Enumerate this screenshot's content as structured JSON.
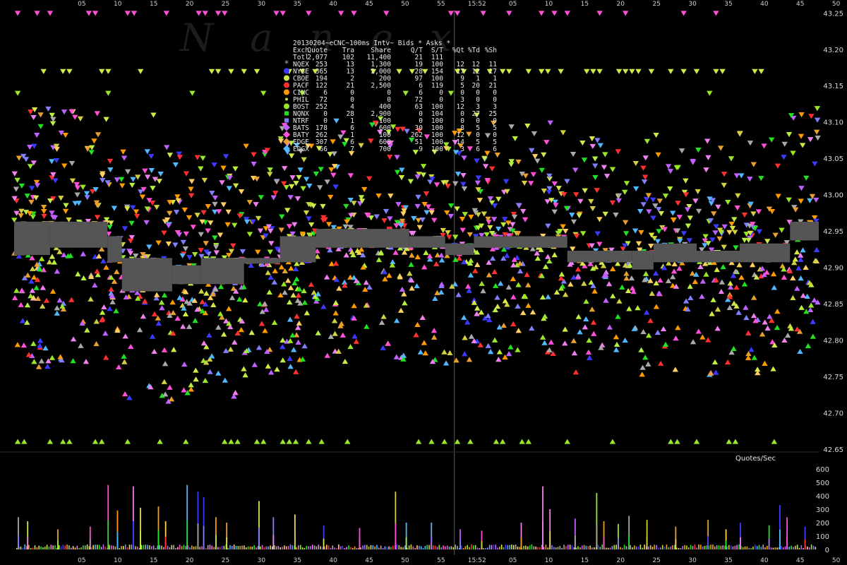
{
  "chart_data": {
    "type": "scatter",
    "title": "20130204~eCNC~100ms Intv~ Bids * Asks *",
    "watermark": "Nanex",
    "price_axis": {
      "min": 42.65,
      "max": 43.26,
      "ticks": [
        "43.25",
        "43.20",
        "43.15",
        "43.10",
        "43.05",
        "43.00",
        "42.95",
        "42.90",
        "42.85",
        "42.80",
        "42.75",
        "42.70",
        "42.65"
      ]
    },
    "volume_axis": {
      "label": "Quotes/Sec",
      "min": 0,
      "max": 620,
      "ticks": [
        "600",
        "500",
        "400",
        "300",
        "200",
        "100",
        "0"
      ]
    },
    "time_axis": {
      "min": 0,
      "max": 112,
      "center_label": "15:52",
      "center_minute": 60,
      "ticks": [
        {
          "m": 5,
          "label": "05"
        },
        {
          "m": 10,
          "label": "10"
        },
        {
          "m": 15,
          "label": "15"
        },
        {
          "m": 20,
          "label": "20"
        },
        {
          "m": 25,
          "label": "25"
        },
        {
          "m": 30,
          "label": "30"
        },
        {
          "m": 35,
          "label": "35"
        },
        {
          "m": 40,
          "label": "40"
        },
        {
          "m": 45,
          "label": "45"
        },
        {
          "m": 50,
          "label": "50"
        },
        {
          "m": 55,
          "label": "55"
        },
        {
          "m": 60,
          "label": "15:52"
        },
        {
          "m": 65,
          "label": "05"
        },
        {
          "m": 70,
          "label": "10"
        },
        {
          "m": 75,
          "label": "15"
        },
        {
          "m": 80,
          "label": "20"
        },
        {
          "m": 85,
          "label": "25"
        },
        {
          "m": 90,
          "label": "30"
        },
        {
          "m": 95,
          "label": "35"
        },
        {
          "m": 100,
          "label": "40"
        },
        {
          "m": 105,
          "label": "45"
        },
        {
          "m": 110,
          "label": "50"
        }
      ]
    },
    "legend": {
      "headers": [
        "Exch",
        "Quote",
        "Tra",
        "Share",
        "Q/T",
        "S/T",
        "%Qt",
        "%Td",
        "%Sh"
      ],
      "total": [
        "Totl",
        "2,077",
        "102",
        "11,400",
        "21",
        "111",
        "",
        "",
        ""
      ],
      "rows": [
        {
          "exch": "NQEX",
          "color": "#a9a9a9",
          "shape": "asterisk",
          "cells": [
            "253",
            "13",
            "1,300",
            "19",
            "100",
            "12",
            "12",
            "11"
          ]
        },
        {
          "exch": "NYSE",
          "color": "#3b3bff",
          "shape": "circle",
          "cells": [
            "365",
            "13",
            "2,000",
            "28",
            "154",
            "17",
            "12",
            "17"
          ]
        },
        {
          "exch": "CBOE",
          "color": "#d4e84a",
          "shape": "circle",
          "cells": [
            "194",
            "2",
            "200",
            "97",
            "100",
            "9",
            "1",
            "1"
          ]
        },
        {
          "exch": "PACF",
          "color": "#ff3030",
          "shape": "circle",
          "cells": [
            "122",
            "21",
            "2,500",
            "6",
            "119",
            "5",
            "20",
            "21"
          ]
        },
        {
          "exch": "CINC",
          "color": "#ff9a00",
          "shape": "circle",
          "cells": [
            "6",
            "0",
            "0",
            "6",
            "0",
            "0",
            "0",
            "0"
          ]
        },
        {
          "exch": "PHIL",
          "color": "#d0d040",
          "shape": "dot",
          "cells": [
            "72",
            "0",
            "0",
            "72",
            "0",
            "3",
            "0",
            "0"
          ]
        },
        {
          "exch": "BOST",
          "color": "#9ae62a",
          "shape": "circle",
          "cells": [
            "252",
            "4",
            "400",
            "63",
            "100",
            "12",
            "3",
            "3"
          ]
        },
        {
          "exch": "NQNX",
          "color": "#22e022",
          "shape": "square",
          "cells": [
            "0",
            "28",
            "2,900",
            "0",
            "104",
            "0",
            "27",
            "25"
          ]
        },
        {
          "exch": "NTRF",
          "color": "#8080ff",
          "shape": "square",
          "cells": [
            "0",
            "1",
            "100",
            "0",
            "100",
            "0",
            "0",
            "0"
          ]
        },
        {
          "exch": "BATS",
          "color": "#c060ff",
          "shape": "diamond",
          "cells": [
            "178",
            "6",
            "600",
            "30",
            "100",
            "8",
            "5",
            "5"
          ]
        },
        {
          "exch": "BATY",
          "color": "#ff50d8",
          "shape": "diamond",
          "cells": [
            "262",
            "1",
            "100",
            "262",
            "100",
            "12",
            "0",
            "0"
          ]
        },
        {
          "exch": "EDGE",
          "color": "#e8a030",
          "shape": "diamond",
          "cells": [
            "307",
            "6",
            "600",
            "51",
            "100",
            "14",
            "5",
            "5"
          ]
        },
        {
          "exch": "EDGX",
          "color": "#4fb8ff",
          "shape": "diamond",
          "cells": [
            "66",
            "7",
            "700",
            "9",
            "100",
            "3",
            "6",
            "6"
          ]
        }
      ]
    },
    "nbbo_band": [
      {
        "t0": 0,
        "t1": 5,
        "lo": 42.92,
        "hi": 42.96
      },
      {
        "t0": 5,
        "t1": 13,
        "lo": 42.93,
        "hi": 42.96
      },
      {
        "t0": 13,
        "t1": 15,
        "lo": 42.91,
        "hi": 42.94
      },
      {
        "t0": 15,
        "t1": 22,
        "lo": 42.87,
        "hi": 42.91
      },
      {
        "t0": 22,
        "t1": 26,
        "lo": 42.88,
        "hi": 42.9
      },
      {
        "t0": 26,
        "t1": 32,
        "lo": 42.88,
        "hi": 42.91
      },
      {
        "t0": 32,
        "t1": 37,
        "lo": 42.91,
        "hi": 42.91
      },
      {
        "t0": 37,
        "t1": 42,
        "lo": 42.91,
        "hi": 42.94
      },
      {
        "t0": 42,
        "t1": 55,
        "lo": 42.93,
        "hi": 42.95
      },
      {
        "t0": 55,
        "t1": 60,
        "lo": 42.93,
        "hi": 42.94
      },
      {
        "t0": 60,
        "t1": 64,
        "lo": 42.92,
        "hi": 42.93
      },
      {
        "t0": 64,
        "t1": 77,
        "lo": 42.93,
        "hi": 42.94
      },
      {
        "t0": 77,
        "t1": 86,
        "lo": 42.91,
        "hi": 42.92
      },
      {
        "t0": 86,
        "t1": 89,
        "lo": 42.9,
        "hi": 42.92
      },
      {
        "t0": 89,
        "t1": 95,
        "lo": 42.91,
        "hi": 42.93
      },
      {
        "t0": 95,
        "t1": 101,
        "lo": 42.91,
        "hi": 42.92
      },
      {
        "t0": 101,
        "t1": 108,
        "lo": 42.91,
        "hi": 42.93
      },
      {
        "t0": 108,
        "t1": 112,
        "lo": 42.94,
        "hi": 42.96
      }
    ],
    "quote_rate_peaks": [
      {
        "m": 0.5,
        "v": 240
      },
      {
        "m": 1.8,
        "v": 210
      },
      {
        "m": 6,
        "v": 150
      },
      {
        "m": 10.5,
        "v": 170
      },
      {
        "m": 13,
        "v": 480
      },
      {
        "m": 14.3,
        "v": 290
      },
      {
        "m": 16.5,
        "v": 470
      },
      {
        "m": 17.5,
        "v": 310
      },
      {
        "m": 20,
        "v": 320
      },
      {
        "m": 21,
        "v": 210
      },
      {
        "m": 24,
        "v": 480
      },
      {
        "m": 25.5,
        "v": 430
      },
      {
        "m": 26.3,
        "v": 390
      },
      {
        "m": 28,
        "v": 240
      },
      {
        "m": 29.5,
        "v": 200
      },
      {
        "m": 34,
        "v": 360
      },
      {
        "m": 36,
        "v": 240
      },
      {
        "m": 39,
        "v": 260
      },
      {
        "m": 43,
        "v": 180
      },
      {
        "m": 48,
        "v": 160
      },
      {
        "m": 53,
        "v": 430
      },
      {
        "m": 54.5,
        "v": 200
      },
      {
        "m": 58,
        "v": 200
      },
      {
        "m": 62,
        "v": 150
      },
      {
        "m": 65,
        "v": 140
      },
      {
        "m": 70.5,
        "v": 200
      },
      {
        "m": 73.5,
        "v": 470
      },
      {
        "m": 74.5,
        "v": 300
      },
      {
        "m": 78,
        "v": 230
      },
      {
        "m": 81,
        "v": 420
      },
      {
        "m": 82,
        "v": 210
      },
      {
        "m": 84,
        "v": 190
      },
      {
        "m": 85.5,
        "v": 250
      },
      {
        "m": 88,
        "v": 220
      },
      {
        "m": 92,
        "v": 170
      },
      {
        "m": 96.5,
        "v": 220
      },
      {
        "m": 99,
        "v": 150
      },
      {
        "m": 101,
        "v": 200
      },
      {
        "m": 105,
        "v": 180
      },
      {
        "m": 106.5,
        "v": 330
      },
      {
        "m": 107.5,
        "v": 240
      },
      {
        "m": 110,
        "v": 170
      }
    ],
    "colors": {
      "background": "#000000",
      "band": "#555555",
      "gridline": "#3a3a3a"
    }
  }
}
